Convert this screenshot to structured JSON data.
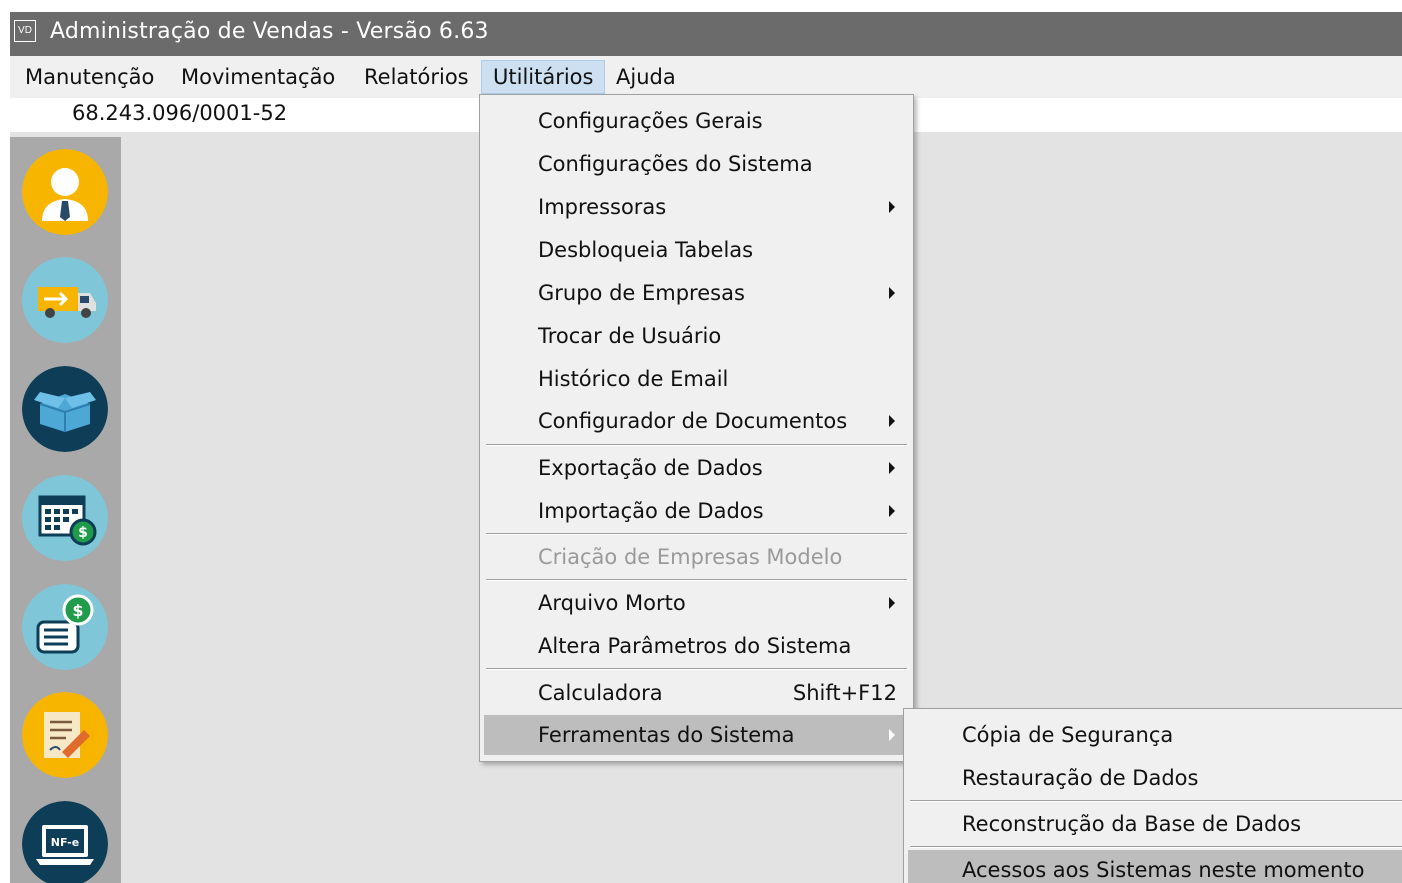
{
  "window": {
    "app_icon_text": "VD",
    "title": "Administração de Vendas - Versão 6.63"
  },
  "menubar": [
    {
      "label": "Manutenção"
    },
    {
      "label": "Movimentação"
    },
    {
      "label": "Relatórios"
    },
    {
      "label": "Utilitários",
      "active": true
    },
    {
      "label": "Ajuda"
    }
  ],
  "company": {
    "cnpj": "68.243.096/0001-52"
  },
  "sidebar": {
    "icons": [
      {
        "name": "user-icon",
        "color": "#f7b500"
      },
      {
        "name": "truck-icon",
        "color": "#7fc6d8"
      },
      {
        "name": "box-icon",
        "color": "#0e3d57"
      },
      {
        "name": "calendar-money-icon",
        "color": "#7fc6d8"
      },
      {
        "name": "money-document-icon",
        "color": "#7fc6d8"
      },
      {
        "name": "document-sign-icon",
        "color": "#f7b500"
      },
      {
        "name": "nfe-laptop-icon",
        "color": "#0e3d57"
      }
    ]
  },
  "utilitarios_menu": {
    "items": [
      {
        "label": "Configurações Gerais"
      },
      {
        "label": "Configurações do Sistema"
      },
      {
        "label": "Impressoras",
        "submenu": true
      },
      {
        "label": "Desbloqueia Tabelas"
      },
      {
        "label": "Grupo de Empresas",
        "submenu": true
      },
      {
        "label": "Trocar de Usuário"
      },
      {
        "label": "Histórico de Email"
      },
      {
        "label": "Configurador de Documentos",
        "submenu": true
      },
      {
        "label": "Exportação de Dados",
        "submenu": true
      },
      {
        "label": "Importação de Dados",
        "submenu": true
      },
      {
        "label": "Criação de Empresas Modelo",
        "disabled": true
      },
      {
        "label": "Arquivo Morto",
        "submenu": true
      },
      {
        "label": "Altera Parâmetros do Sistema"
      },
      {
        "label": "Calculadora",
        "shortcut": "Shift+F12"
      },
      {
        "label": "Ferramentas do Sistema",
        "submenu": true,
        "highlighted": true
      }
    ]
  },
  "ferramentas_submenu": {
    "items": [
      {
        "label": "Cópia de Segurança"
      },
      {
        "label": "Restauração de Dados"
      },
      {
        "label": "Reconstrução da Base de Dados"
      },
      {
        "label": "Acessos aos Sistemas neste momento",
        "highlighted": true
      }
    ]
  },
  "colors": {
    "titlebar": "#6b6b6b",
    "sidebar": "#a9a9a9",
    "workspace": "#e3e3e3",
    "menu_bg": "#f0f0f0",
    "highlight": "#bdbdbd"
  }
}
